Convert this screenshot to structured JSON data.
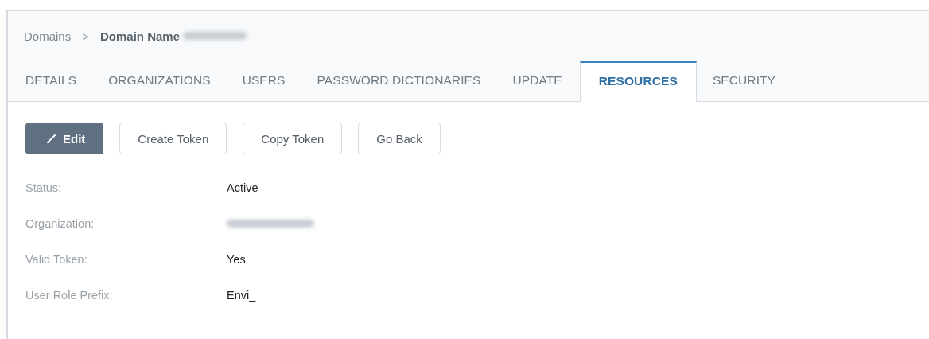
{
  "breadcrumb": {
    "parent": "Domains",
    "separator": ">",
    "current": "Domain Name",
    "current_redacted_suffix": true
  },
  "tabs": [
    {
      "label": "DETAILS",
      "selected": false
    },
    {
      "label": "ORGANIZATIONS",
      "selected": false
    },
    {
      "label": "USERS",
      "selected": false
    },
    {
      "label": "PASSWORD DICTIONARIES",
      "selected": false
    },
    {
      "label": "UPDATE",
      "selected": false
    },
    {
      "label": "RESOURCES",
      "selected": true
    },
    {
      "label": "SECURITY",
      "selected": false
    }
  ],
  "buttons": [
    {
      "label": "Edit",
      "kind": "primary"
    },
    {
      "label": "Create Token",
      "kind": "default"
    },
    {
      "label": "Copy Token",
      "kind": "default"
    },
    {
      "label": "Go Back",
      "kind": "default"
    }
  ],
  "fields": [
    {
      "label": "Status:",
      "kind": "text",
      "value": "Active"
    },
    {
      "label": "Organization:",
      "kind": "redacted"
    },
    {
      "label": "Valid Token:",
      "kind": "text",
      "value": "Yes"
    },
    {
      "label": "User Role Prefix:",
      "kind": "text",
      "value": "Envi_"
    }
  ]
}
